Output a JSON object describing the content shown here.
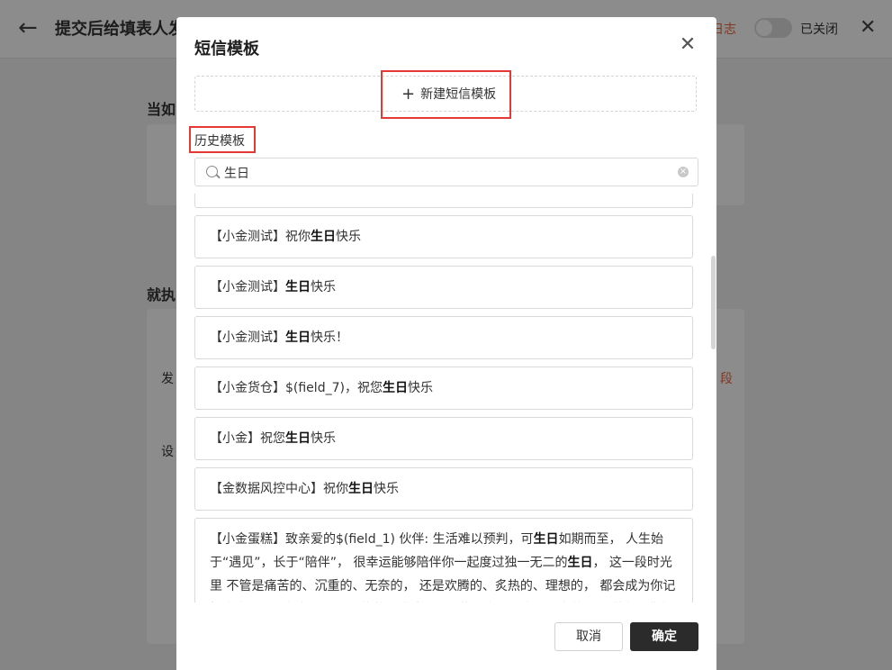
{
  "page": {
    "title": "提交后给填表人发",
    "log_link": "日志",
    "toggle_label": "已关闭",
    "bg_section1": "当如",
    "bg_section2": "就执",
    "bg_label1": "发",
    "bg_label2": "设",
    "bg_field_link": "段"
  },
  "modal": {
    "title": "短信模板",
    "new_template_label": "新建短信模板",
    "history_label": "历史模板",
    "search_value": "生日",
    "cancel_label": "取消",
    "confirm_label": "确定",
    "templates": [
      {
        "before": "【小金测试】祝你",
        "keyword": "生日",
        "after": "快乐"
      },
      {
        "before": "【小金测试】",
        "keyword": "生日",
        "after": "快乐"
      },
      {
        "before": "【小金测试】",
        "keyword": "生日",
        "after": "快乐！"
      },
      {
        "before": "【小金货仓】$(field_7)，祝您",
        "keyword": "生日",
        "after": "快乐"
      },
      {
        "before": "【小金】祝您",
        "keyword": "生日",
        "after": "快乐"
      },
      {
        "before": "【金数据风控中心】祝你",
        "keyword": "生日",
        "after": "快乐"
      }
    ],
    "long_template": {
      "part1": "【小金蛋糕】致亲爱的$(field_1) 伙伴: 生活难以预判，可",
      "keyword1": "生日",
      "part2": "如期而至， 人生始于“遇见”，长于“陪伴”， 很幸运能够陪伴你一起度过独一无二的",
      "keyword2": "生日",
      "part3": "， 这一段时光里 不管是痛苦的、沉重的、无奈的， 还是欢腾的、炙热的、理想的， 都会成为你记忆当中，不可复制，永不后悔的闪亮岁月! 在此小金愿你生活里有热汤和甜食，背包里有书本和"
    }
  },
  "colors": {
    "highlight_box": "#e53935",
    "confirm_button": "#2b2b2b",
    "log_link": "#e8663d"
  }
}
